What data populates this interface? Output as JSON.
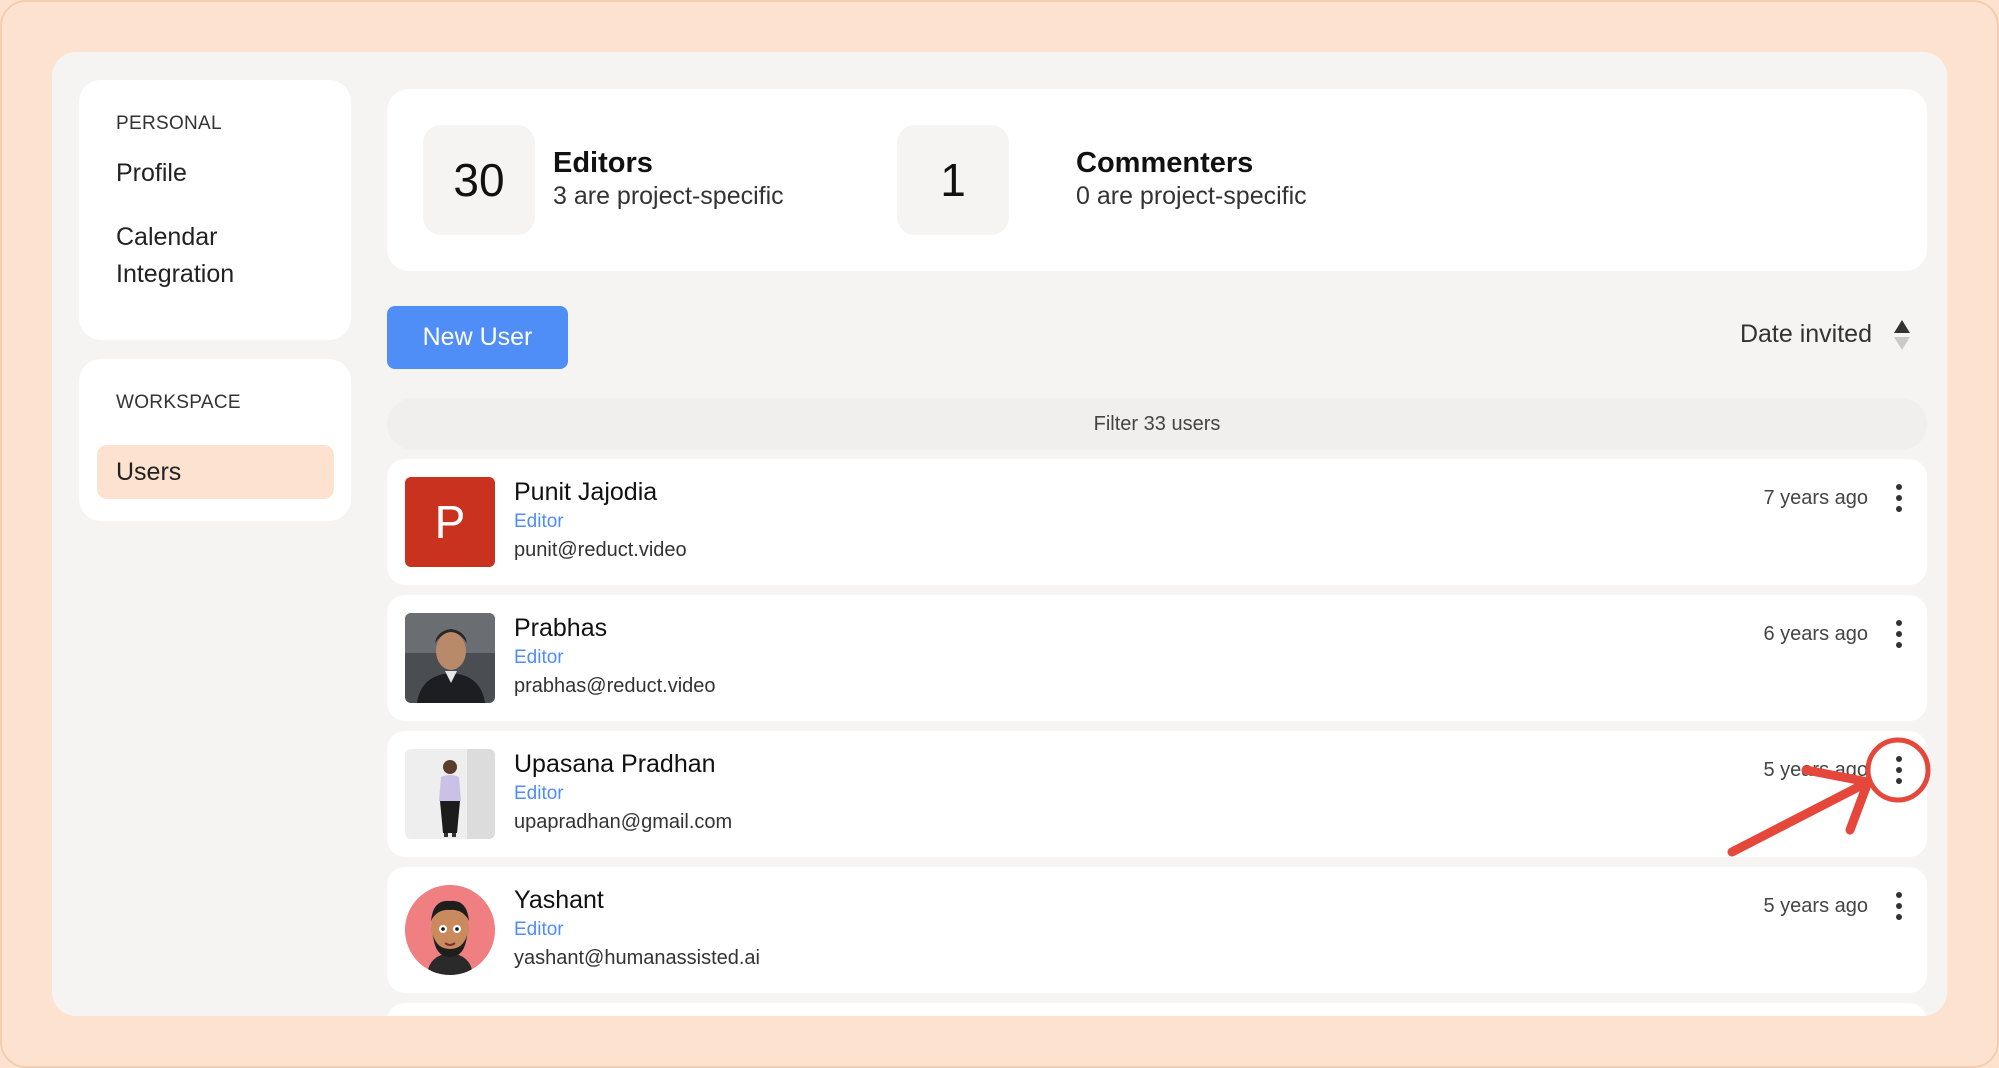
{
  "sidebar": {
    "personal_heading": "PERSONAL",
    "personal_items": [
      "Profile",
      "Calendar",
      "Integration"
    ],
    "workspace_heading": "WORKSPACE",
    "workspace_items": [
      "Users"
    ]
  },
  "stats": [
    {
      "count": "30",
      "title": "Editors",
      "subtitle": "3 are project-specific"
    },
    {
      "count": "1",
      "title": "Commenters",
      "subtitle": "0 are project-specific"
    }
  ],
  "toolbar": {
    "new_user_label": "New User",
    "sort_label": "Date invited",
    "filter_placeholder": "Filter 33 users"
  },
  "users": [
    {
      "name": "Punit Jajodia",
      "role": "Editor",
      "email": "punit@reduct.video",
      "time": "7 years ago",
      "avatar_letter": "P"
    },
    {
      "name": "Prabhas",
      "role": "Editor",
      "email": "prabhas@reduct.video",
      "time": "6 years ago"
    },
    {
      "name": "Upasana Pradhan",
      "role": "Editor",
      "email": "upapradhan@gmail.com",
      "time": "5 years ago"
    },
    {
      "name": "Yashant",
      "role": "Editor",
      "email": "yashant@humanassisted.ai",
      "time": "5 years ago"
    }
  ],
  "colors": {
    "accent": "#4f8ef7",
    "frame": "#fde3cf",
    "annotation": "#e5483a",
    "avatar_letter_bg": "#c8321f"
  }
}
